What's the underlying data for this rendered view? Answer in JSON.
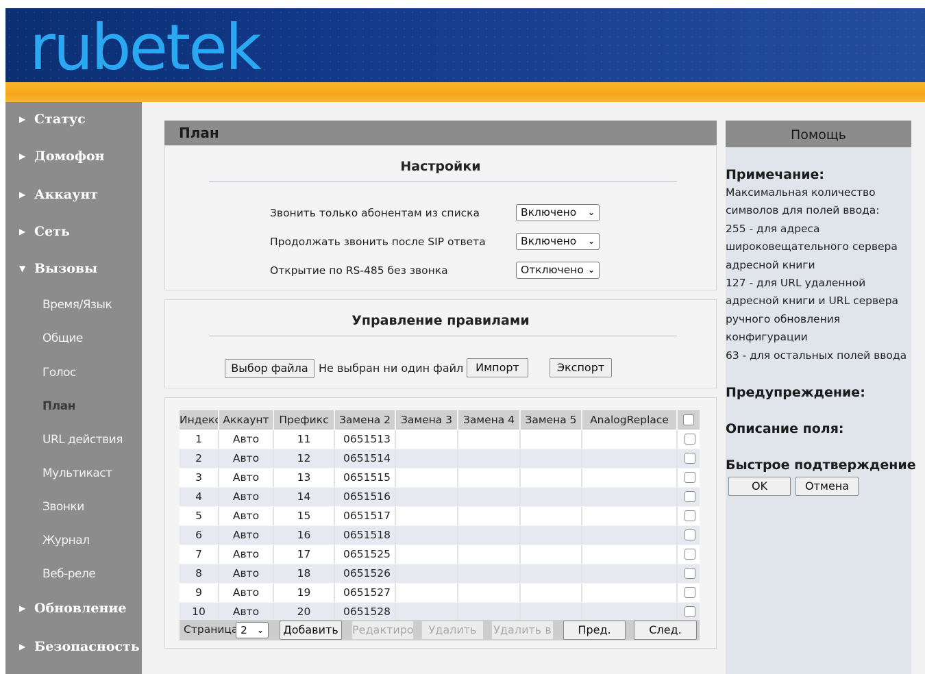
{
  "brand": {
    "logo_text": "rubetek"
  },
  "sidebar": {
    "items": [
      {
        "label": "Статус",
        "arrow": "▶"
      },
      {
        "label": "Домофон",
        "arrow": "▶"
      },
      {
        "label": "Аккаунт",
        "arrow": "▶"
      },
      {
        "label": "Сеть",
        "arrow": "▶"
      },
      {
        "label": "Вызовы",
        "arrow": "▼"
      },
      {
        "label": "Обновление",
        "arrow": "▶"
      },
      {
        "label": "Безопасность",
        "arrow": "▶"
      }
    ],
    "subitems": [
      "Время/Язык",
      "Общие",
      "Голос",
      "План",
      "URL действия",
      "Мультикаст",
      "Звонки",
      "Журнал",
      "Веб-реле"
    ],
    "active_subitem": "План"
  },
  "main": {
    "title": "План",
    "settings": {
      "title": "Настройки",
      "rows": [
        {
          "label": "Звонить только абонентам из списка",
          "value": "Включено"
        },
        {
          "label": "Продолжать звонить после SIP ответа",
          "value": "Включено"
        },
        {
          "label": "Открытие по RS-485 без звонка",
          "value": "Отключено"
        }
      ]
    },
    "rules": {
      "title": "Управление правилами",
      "choose_file": "Выбор файла",
      "no_file": "Не выбран ни один файл",
      "import": "Импорт",
      "export": "Экспорт"
    },
    "table": {
      "headers": [
        "Индекс",
        "Аккаунт",
        "Префикс",
        "Замена 2",
        "Замена 3",
        "Замена 4",
        "Замена 5",
        "AnalogReplace"
      ],
      "rows": [
        [
          "1",
          "Авто",
          "11",
          "0651513"
        ],
        [
          "2",
          "Авто",
          "12",
          "0651514"
        ],
        [
          "3",
          "Авто",
          "13",
          "0651515"
        ],
        [
          "4",
          "Авто",
          "14",
          "0651516"
        ],
        [
          "5",
          "Авто",
          "15",
          "0651517"
        ],
        [
          "6",
          "Авто",
          "16",
          "0651518"
        ],
        [
          "7",
          "Авто",
          "17",
          "0651525"
        ],
        [
          "8",
          "Авто",
          "18",
          "0651526"
        ],
        [
          "9",
          "Авто",
          "19",
          "0651527"
        ],
        [
          "10",
          "Авто",
          "20",
          "0651528"
        ]
      ]
    },
    "pager": {
      "page_label": "Страница",
      "page_value": "2",
      "add": "Добавить",
      "edit": "Редактиро",
      "delete": "Удалить",
      "delete_all": "Удалить в",
      "prev": "Пред.",
      "next": "След."
    }
  },
  "help": {
    "header": "Помощь",
    "note_title": "Примечание:",
    "note_lines": [
      "Максимальная количество",
      "символов для полей ввода:",
      "255 - для адреса",
      "широковещательного сервера",
      "адресной книги",
      "127 - для URL удаленной",
      "адресной книги и URL сервера",
      "ручного обновления",
      "конфигурации",
      "63 - для остальных полей ввода"
    ],
    "warning_title": "Предупреждение:",
    "field_desc_title": "Описание поля:",
    "quick_confirm_title": "Быстрое подтверждение",
    "ok": "OK",
    "cancel": "Отмена"
  }
}
